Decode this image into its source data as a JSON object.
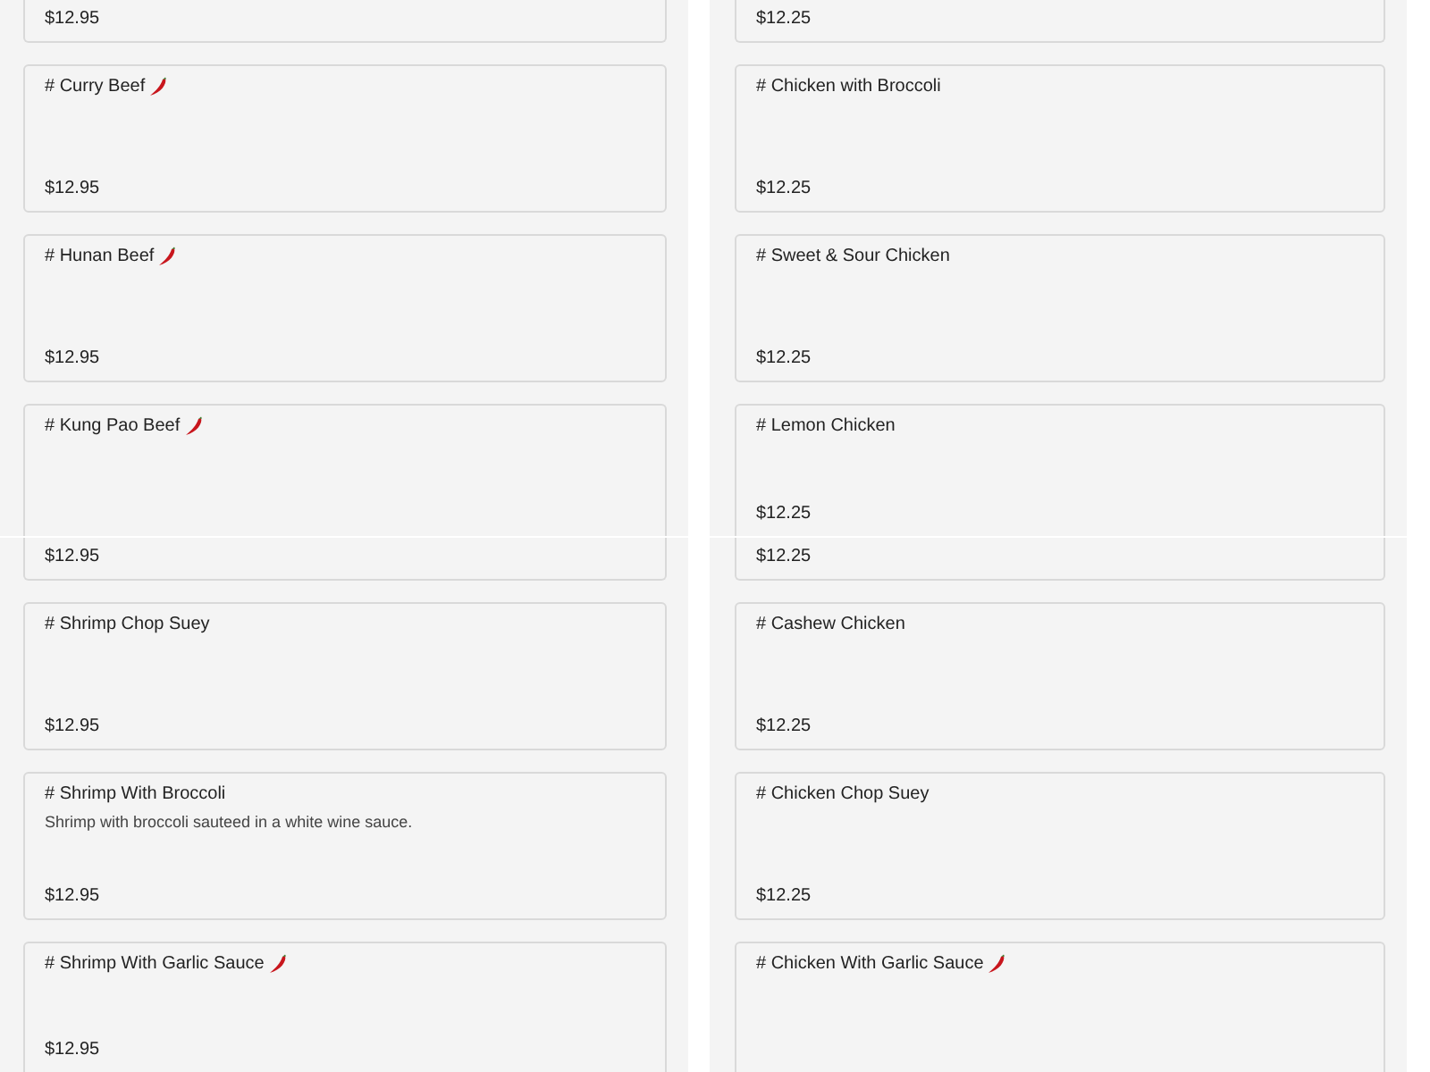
{
  "panels": [
    {
      "columns": [
        {
          "cards": [
            {
              "kind": "tail",
              "price": "$12.95"
            },
            {
              "kind": "full",
              "title": "# Curry Beef",
              "spicy": true,
              "price": "$12.95"
            },
            {
              "kind": "full",
              "title": "# Hunan Beef",
              "spicy": true,
              "price": "$12.95"
            },
            {
              "kind": "head",
              "title": "# Kung Pao Beef",
              "spicy": true
            }
          ]
        },
        {
          "cards": [
            {
              "kind": "tail",
              "price": "$12.25"
            },
            {
              "kind": "full",
              "title": "# Chicken with Broccoli",
              "spicy": false,
              "price": "$12.25"
            },
            {
              "kind": "full",
              "title": "# Sweet & Sour Chicken",
              "spicy": false,
              "price": "$12.25"
            },
            {
              "kind": "head",
              "title": "# Lemon Chicken",
              "spicy": false,
              "price": "$12.25"
            }
          ]
        }
      ]
    },
    {
      "columns": [
        {
          "cards": [
            {
              "kind": "tail",
              "price": "$12.95"
            },
            {
              "kind": "full",
              "title": "# Shrimp Chop Suey",
              "spicy": false,
              "price": "$12.95"
            },
            {
              "kind": "full",
              "title": "# Shrimp With Broccoli",
              "spicy": false,
              "description": "Shrimp with broccoli sauteed in a white wine sauce.",
              "price": "$12.95"
            },
            {
              "kind": "head",
              "title": "# Shrimp With Garlic Sauce",
              "spicy": true,
              "price": "$12.95"
            }
          ]
        },
        {
          "cards": [
            {
              "kind": "tail",
              "price": "$12.25"
            },
            {
              "kind": "full",
              "title": "# Cashew Chicken",
              "spicy": false,
              "price": "$12.25"
            },
            {
              "kind": "full",
              "title": "# Chicken Chop Suey",
              "spicy": false,
              "price": "$12.25"
            },
            {
              "kind": "head",
              "title": "# Chicken With Garlic Sauce",
              "spicy": true
            }
          ]
        }
      ]
    }
  ]
}
